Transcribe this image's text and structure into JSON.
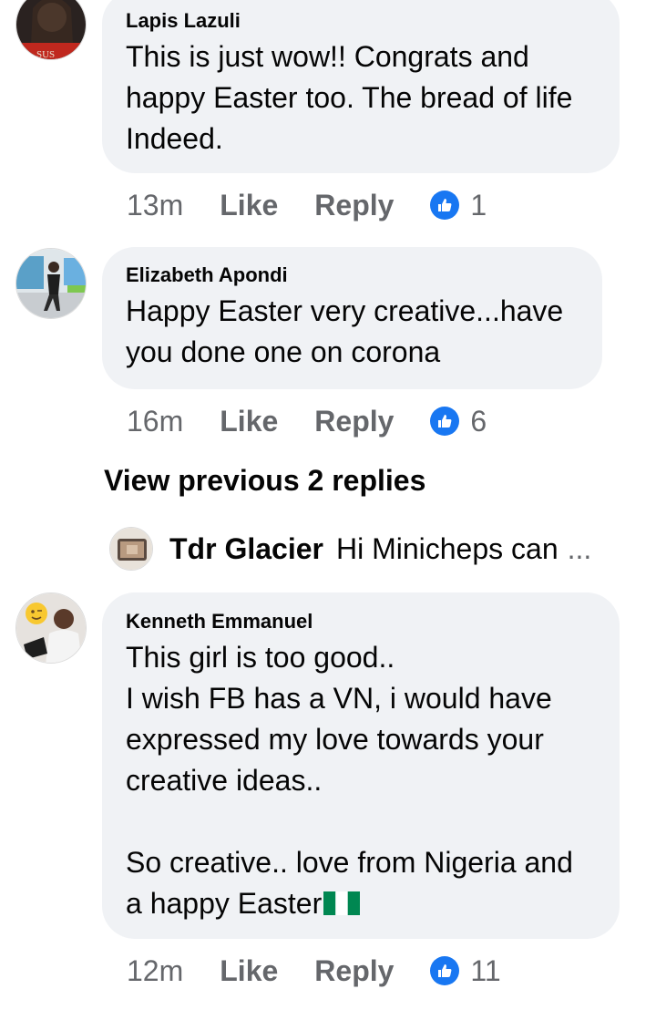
{
  "comments": [
    {
      "author": "Lapis Lazuli",
      "text": "This is just wow!! Congrats and\nhappy Easter too. The bread of life\nIndeed.",
      "time": "13m",
      "like_label": "Like",
      "reply_label": "Reply",
      "reactions": "1"
    },
    {
      "author": "Elizabeth Apondi",
      "text": "Happy Easter very creative...have\nyou done one on corona",
      "time": "16m",
      "like_label": "Like",
      "reply_label": "Reply",
      "reactions": "6"
    },
    {
      "author": "Kenneth Emmanuel",
      "text": "This girl is too good..\nI wish FB has a VN, i would have\nexpressed my love towards your\ncreative ideas..\n\nSo creative.. love from Nigeria and\na happy Easter",
      "time": "12m",
      "like_label": "Like",
      "reply_label": "Reply",
      "reactions": "11"
    }
  ],
  "view_previous": "View previous 2 replies",
  "reply_preview": {
    "author": "Tdr Glacier",
    "text": "Hi Minicheps can",
    "ellipsis": "..."
  },
  "avatar_text": "SUS",
  "colors": {
    "bubble": "#f0f2f5",
    "meta": "#65676b",
    "like_blue": "#1877f2"
  },
  "icons": [
    "like-reaction-icon",
    "nigeria-flag-emoji"
  ]
}
